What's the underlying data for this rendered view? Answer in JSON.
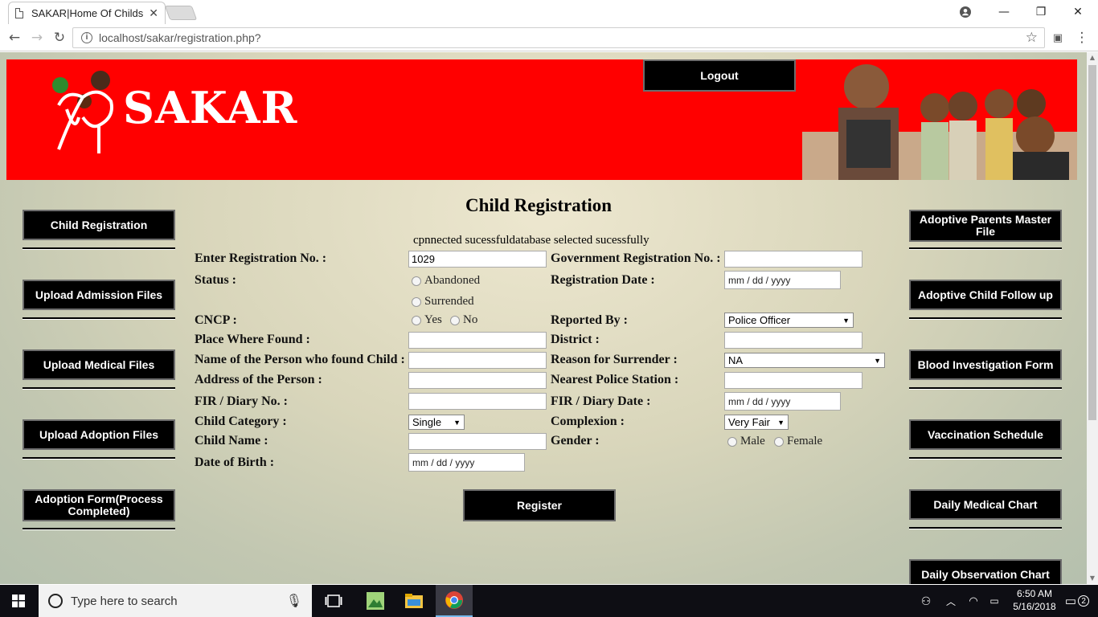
{
  "browser": {
    "tab_title": "SAKAR|Home Of Childs",
    "url": "localhost/sakar/registration.php?"
  },
  "header": {
    "brand": "SAKAR",
    "logout_label": "Logout"
  },
  "left_nav": [
    {
      "label": "Child Registration"
    },
    {
      "label": "Upload Admission Files"
    },
    {
      "label": "Upload Medical Files"
    },
    {
      "label": "Upload Adoption Files"
    },
    {
      "label": "Adoption Form(Process Completed)"
    }
  ],
  "right_nav": [
    {
      "label": "Adoptive Parents Master File"
    },
    {
      "label": "Adoptive Child Follow up"
    },
    {
      "label": "Blood Investigation Form"
    },
    {
      "label": "Vaccination Schedule"
    },
    {
      "label": "Daily Medical Chart"
    },
    {
      "label": "Daily Observation Chart"
    }
  ],
  "form": {
    "title": "Child Registration",
    "message": "cpnnected sucessfuldatabase selected sucessfully",
    "labels": {
      "reg_no": "Enter Registration No. :",
      "gov_reg_no": "Government Registration No. :",
      "status": "Status :",
      "reg_date": "Registration Date :",
      "cncp": "CNCP :",
      "reported_by": "Reported By :",
      "place_found": "Place Where Found :",
      "district": "District :",
      "finder_name": "Name of the Person who found Child :",
      "reason": "Reason for Surrender :",
      "address": "Address of the Person :",
      "police_station": "Nearest Police Station :",
      "fir_no": "FIR / Diary No. :",
      "fir_date": "FIR / Diary Date :",
      "category": "Child Category :",
      "complexion": "Complexion :",
      "child_name": "Child Name :",
      "gender": "Gender :",
      "dob": "Date of Birth :"
    },
    "values": {
      "reg_no": "1029",
      "date_placeholder": "mm / dd / yyyy",
      "reported_by": "Police Officer",
      "reason": "NA",
      "category": "Single",
      "complexion": "Very Fair"
    },
    "options": {
      "status": [
        "Abandoned",
        "Surrended"
      ],
      "cncp": [
        "Yes",
        "No"
      ],
      "gender": [
        "Male",
        "Female"
      ]
    },
    "submit_label": "Register"
  },
  "taskbar": {
    "search_placeholder": "Type here to search",
    "time": "6:50 AM",
    "date": "5/16/2018",
    "notifications": "2"
  }
}
